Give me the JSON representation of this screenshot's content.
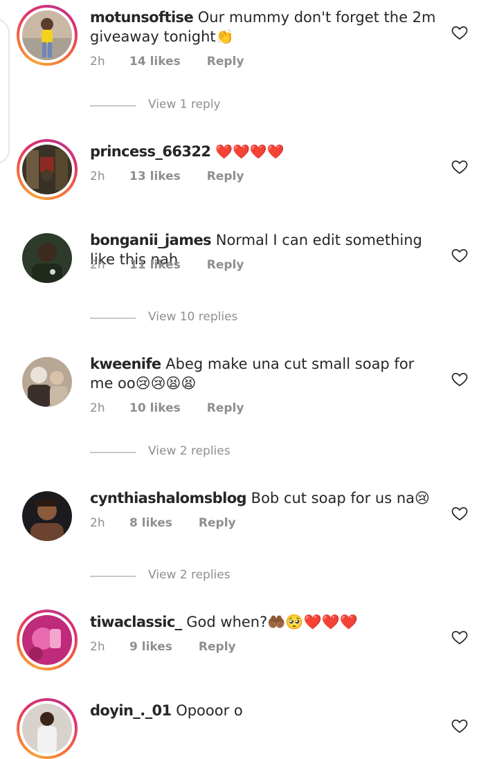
{
  "comments": [
    {
      "username": "motunsoftise",
      "text": "Our mummy don't forget the 2m giveaway tonight👏",
      "time": "2h",
      "likes": "14 likes",
      "reply": "Reply",
      "view_replies": "View 1 reply",
      "has_story": true
    },
    {
      "username": "princess_66322",
      "text": "❤️❤️❤️❤️",
      "time": "2h",
      "likes": "13 likes",
      "reply": "Reply",
      "has_story": true
    },
    {
      "username": "bonganii_james",
      "text": "Normal I can edit something like this nah",
      "time": "2h",
      "likes": "11 likes",
      "reply": "Reply",
      "view_replies": "View 10 replies",
      "has_story": false
    },
    {
      "username": "kweenife",
      "text": "Abeg  make una cut small soap for me oo😢😢😫😫",
      "time": "2h",
      "likes": "10 likes",
      "reply": "Reply",
      "view_replies": "View 2 replies",
      "has_story": false
    },
    {
      "username": "cynthiashalomsblog",
      "text": "Bob cut soap for us na😢",
      "time": "2h",
      "likes": "8 likes",
      "reply": "Reply",
      "view_replies": "View 2 replies",
      "has_story": false
    },
    {
      "username": "tiwaclassic_",
      "text": "God when?🤲🏾🥺❤️❤️❤️",
      "time": "2h",
      "likes": "9 likes",
      "reply": "Reply",
      "has_story": true
    },
    {
      "username": "doyin_._01",
      "text": "Opooor o",
      "has_story": true
    }
  ],
  "icons": {
    "like": "heart-outline-icon"
  },
  "colors": {
    "text": "#262626",
    "secondary": "#8e8e8e",
    "story_ring_start": "#f9a137",
    "story_ring_end": "#c13584"
  }
}
